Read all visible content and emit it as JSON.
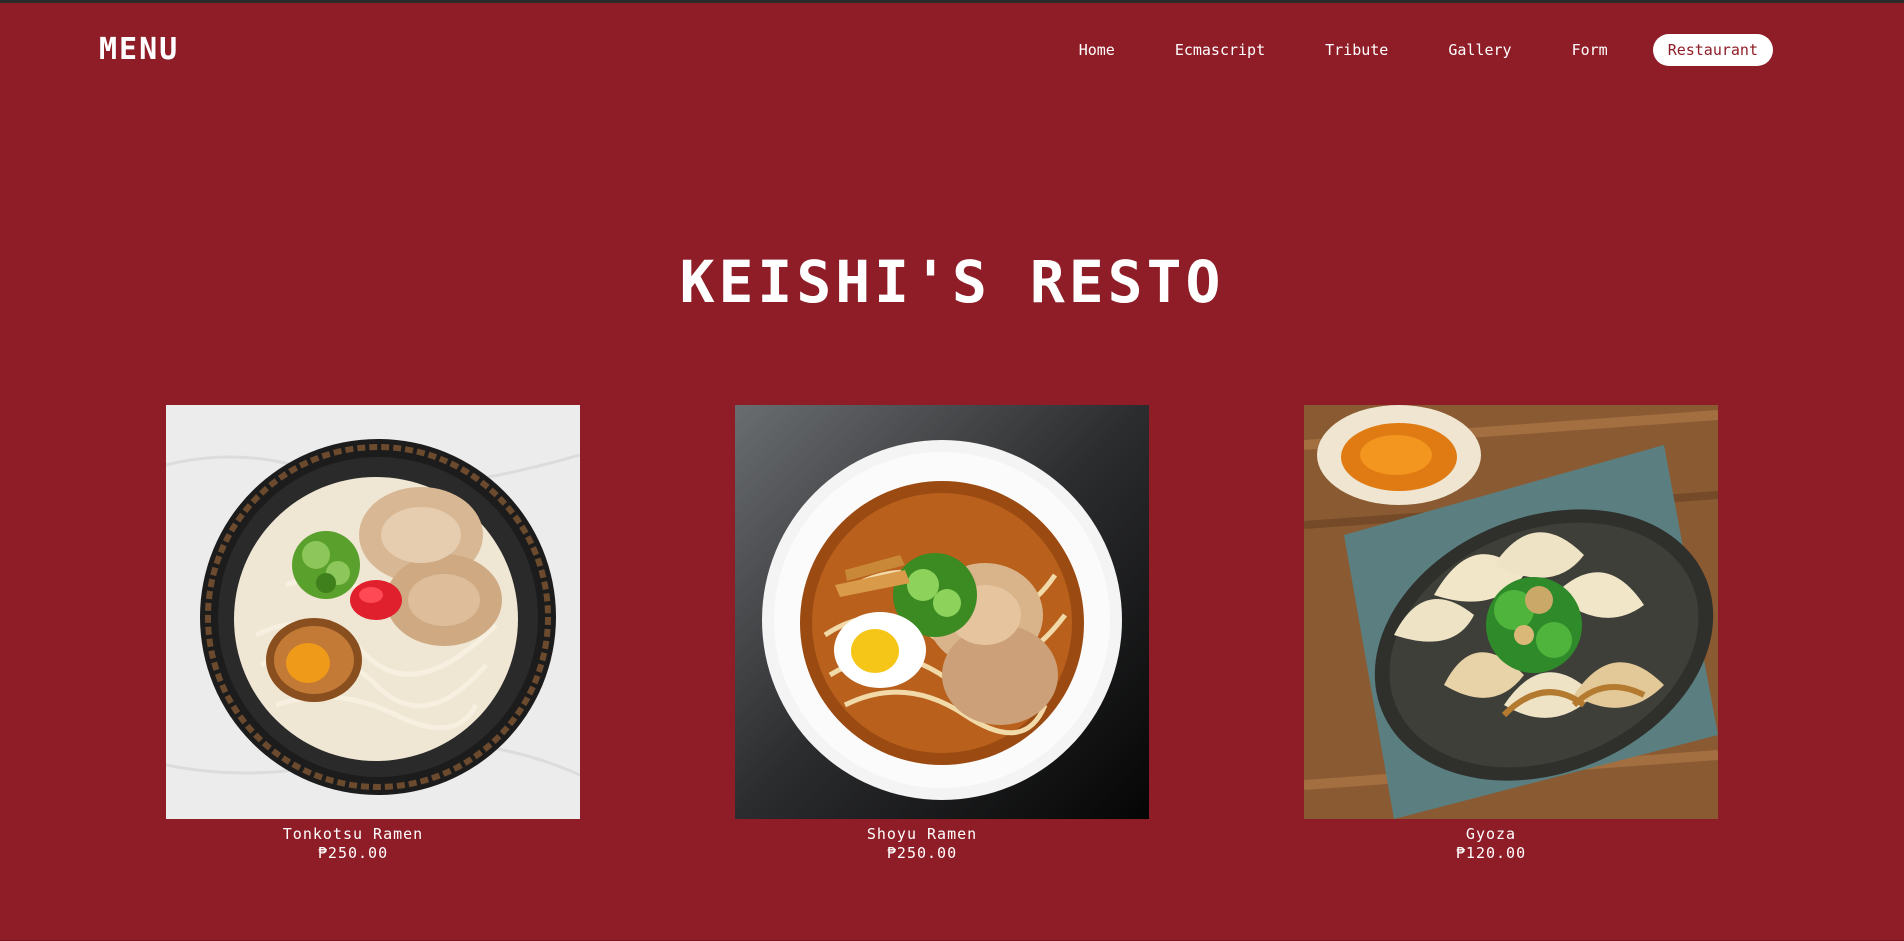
{
  "nav": {
    "brand": "MENU",
    "links": [
      {
        "label": "Home"
      },
      {
        "label": "Ecmascript"
      },
      {
        "label": "Tribute"
      },
      {
        "label": "Gallery"
      },
      {
        "label": "Form"
      },
      {
        "label": "Restaurant",
        "active": true
      }
    ]
  },
  "page": {
    "title": "KEISHI'S RESTO"
  },
  "menu": {
    "items": [
      {
        "name": "Tonkotsu Ramen",
        "price": "₱250.00",
        "photo": "tonkotsu-ramen-photo"
      },
      {
        "name": "Shoyu Ramen",
        "price": "₱250.00",
        "photo": "shoyu-ramen-photo"
      },
      {
        "name": "Gyoza",
        "price": "₱120.00",
        "photo": "gyoza-photo"
      }
    ]
  },
  "colors": {
    "background": "#8f1d27",
    "text": "#ffffff",
    "active_pill_bg": "#ffffff",
    "active_pill_text": "#8f1d27"
  }
}
